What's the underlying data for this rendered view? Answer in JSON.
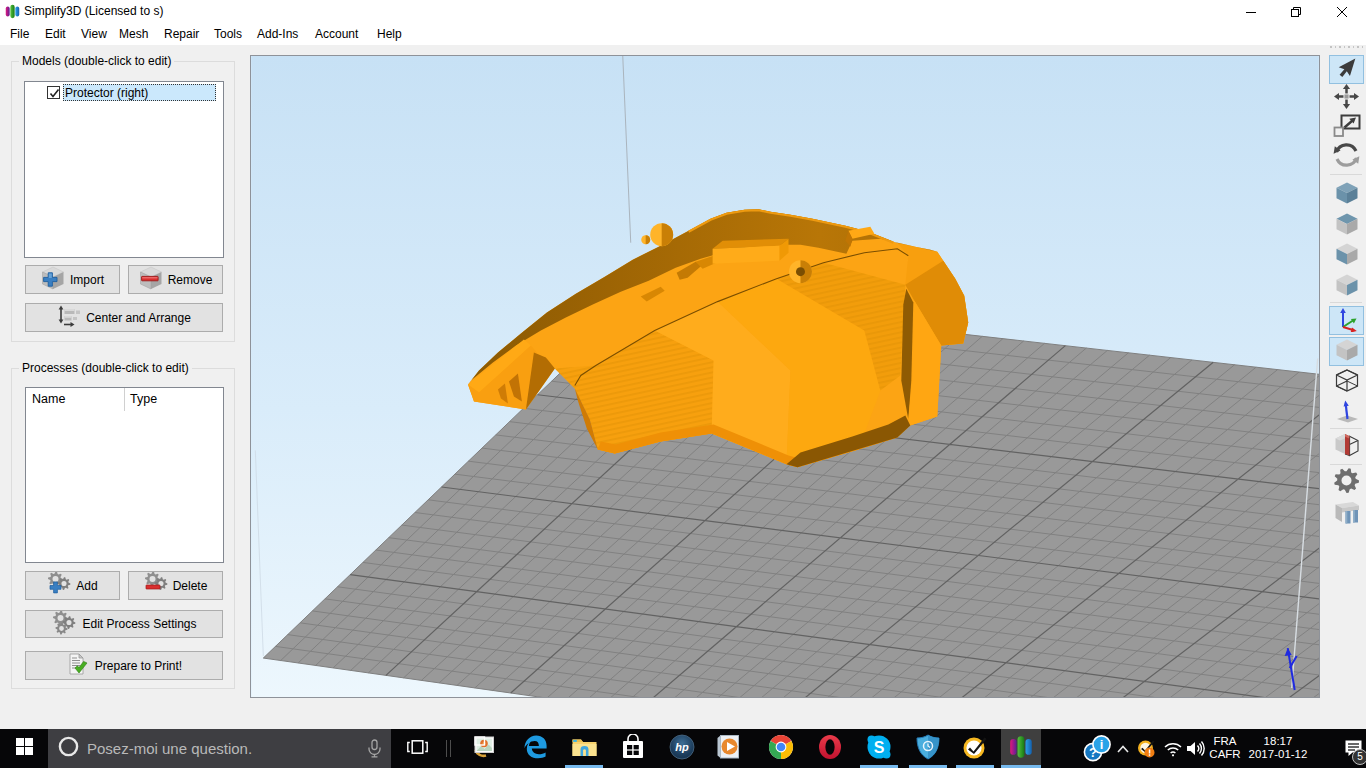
{
  "window": {
    "title": "Simplify3D (Licensed to s)"
  },
  "menubar": {
    "items": [
      "File",
      "Edit",
      "View",
      "Mesh",
      "Repair",
      "Tools",
      "Add-Ins",
      "Account",
      "Help"
    ]
  },
  "left_panel": {
    "models_group": {
      "label": "Models (double-click to edit)",
      "items": [
        {
          "label": "Protector (right)",
          "checked": true
        }
      ],
      "buttons": {
        "import": "Import",
        "remove": "Remove",
        "center_arrange": "Center and Arrange"
      }
    },
    "processes_group": {
      "label": "Processes (double-click to edit)",
      "columns": {
        "name": "Name",
        "type": "Type"
      },
      "rows": [],
      "buttons": {
        "add": "Add",
        "delete": "Delete",
        "edit": "Edit Process Settings",
        "prepare": "Prepare to Print!"
      }
    }
  },
  "toolbar": {
    "tools": [
      "select",
      "move",
      "scale",
      "rotate",
      "view-default",
      "view-top",
      "view-front",
      "view-side",
      "show-axes",
      "show-solid",
      "show-wireframe",
      "show-normals",
      "cross-section",
      "settings",
      "support-structures"
    ],
    "active": [
      "select",
      "show-axes",
      "show-solid"
    ]
  },
  "viewport": {
    "model": "Protector (right)",
    "sky_top": "#c7e1f5",
    "sky_bottom": "#edf7fd",
    "plate_color": "#989898",
    "model_color": "#fca414"
  },
  "taskbar": {
    "search": {
      "placeholder": "Posez-moi une question."
    },
    "apps": [
      {
        "name": "photos"
      },
      {
        "name": "edge"
      },
      {
        "name": "file-explorer",
        "running": true
      },
      {
        "name": "store"
      },
      {
        "name": "hp"
      },
      {
        "name": "media-player"
      },
      {
        "name": "chrome"
      },
      {
        "name": "opera"
      },
      {
        "name": "skype",
        "running": true
      },
      {
        "name": "security-shield",
        "running": true
      },
      {
        "name": "norton",
        "running": true
      },
      {
        "name": "simplify3d",
        "running": true,
        "active": true
      }
    ],
    "tray": {
      "language": "FRA",
      "language_region": "CAFR",
      "time": "18:17",
      "date": "2017-01-12",
      "notification_count": "5"
    }
  }
}
